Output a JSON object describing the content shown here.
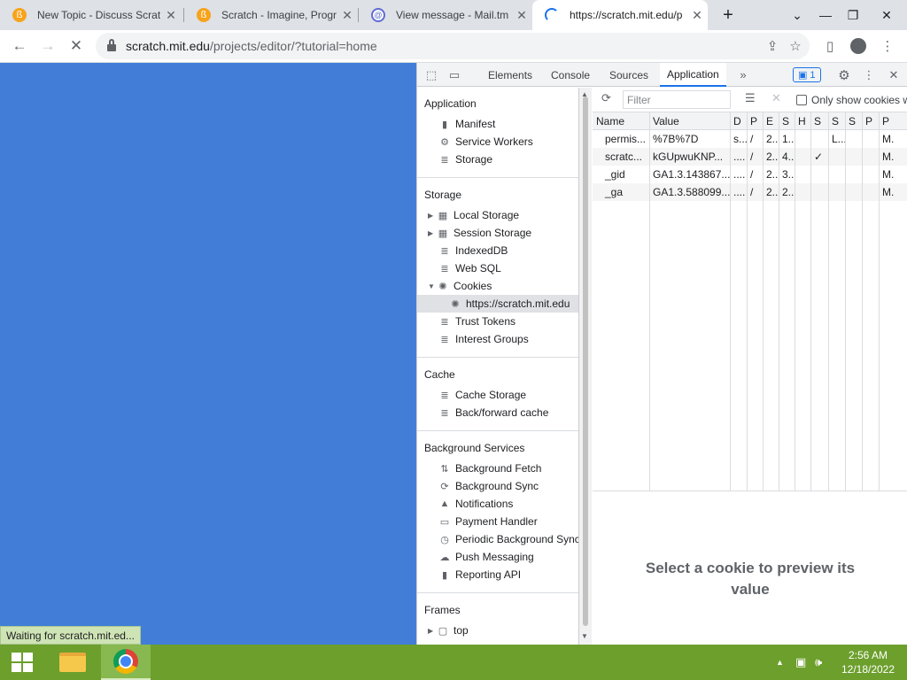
{
  "tabs": [
    {
      "title": "New Topic - Discuss Scrat",
      "icon": "scratch-favicon"
    },
    {
      "title": "Scratch - Imagine, Progra",
      "icon": "scratch-favicon"
    },
    {
      "title": "View message - Mail.tm",
      "icon": "mail-favicon"
    },
    {
      "title": "https://scratch.mit.edu/p",
      "icon": "loading-spinner"
    }
  ],
  "toolbar": {
    "url_host": "scratch.mit.edu",
    "url_path": "/projects/editor/?tutorial=home"
  },
  "status_text": "Waiting for scratch.mit.ed...",
  "devtools": {
    "tabs": [
      "Elements",
      "Console",
      "Sources",
      "Application"
    ],
    "active_tab": "Application",
    "issues_count": "1",
    "sidebar": {
      "application_title": "Application",
      "application_items": [
        "Manifest",
        "Service Workers",
        "Storage"
      ],
      "storage_title": "Storage",
      "storage_items": [
        "Local Storage",
        "Session Storage",
        "IndexedDB",
        "Web SQL",
        "Cookies",
        "https://scratch.mit.edu",
        "Trust Tokens",
        "Interest Groups"
      ],
      "cache_title": "Cache",
      "cache_items": [
        "Cache Storage",
        "Back/forward cache"
      ],
      "bg_title": "Background Services",
      "bg_items": [
        "Background Fetch",
        "Background Sync",
        "Notifications",
        "Payment Handler",
        "Periodic Background Sync",
        "Push Messaging",
        "Reporting API"
      ],
      "frames_title": "Frames",
      "frames_items": [
        "top"
      ]
    },
    "filter_placeholder": "Filter",
    "only_show_label": "Only show cookies w",
    "columns": [
      "Name",
      "Value",
      "D",
      "P",
      "E",
      "S",
      "H",
      "S",
      "S",
      "S",
      "P",
      "P"
    ],
    "rows": [
      [
        "permis...",
        "%7B%7D",
        "s...",
        "/",
        "2...",
        "1...",
        "",
        "",
        "L...",
        "",
        "",
        "M."
      ],
      [
        "scratc...",
        "kGUpwuKNP...",
        "....",
        "/",
        "2...",
        "4...",
        "",
        "✓",
        "",
        "",
        "",
        "M."
      ],
      [
        "_gid",
        "GA1.3.143867...",
        "....",
        "/",
        "2...",
        "3...",
        "",
        "",
        "",
        "",
        "",
        "M."
      ],
      [
        "_ga",
        "GA1.3.588099...",
        "....",
        "/",
        "2...",
        "2...",
        "",
        "",
        "",
        "",
        "",
        "M."
      ]
    ],
    "preview_text": "Select a cookie to preview its value"
  },
  "taskbar": {
    "time": "2:56 AM",
    "date": "12/18/2022"
  }
}
